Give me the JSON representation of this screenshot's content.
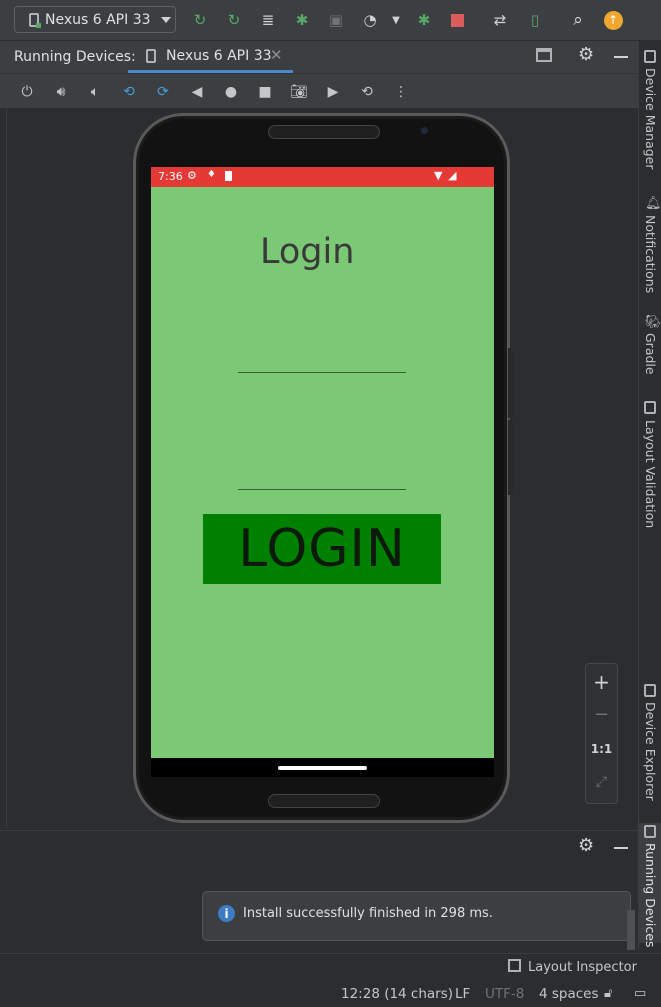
{
  "toolbar": {
    "device_selector": "Nexus 6 API 33",
    "icons": [
      "apply-changes-icon",
      "apply-code-changes-icon",
      "logcat-icon",
      "debug-icon",
      "attach-debugger-icon",
      "profiler-icon",
      "dropdown-icon",
      "debug-app-icon",
      "stop-icon",
      "device-manager-icon",
      "sync-icon",
      "search-icon",
      "update-icon"
    ]
  },
  "running_devices": {
    "label": "Running Devices:",
    "tab": "Nexus 6 API 33"
  },
  "phone": {
    "status_time": "7:36",
    "title": "Login",
    "button": "LOGIN"
  },
  "zoom": {
    "plus": "+",
    "minus": "−",
    "one_to_one": "1:1"
  },
  "right_panel": {
    "device_manager": "Device Manager",
    "notifications": "Notifications",
    "gradle": "Gradle",
    "layout_validation": "Layout Validation",
    "device_explorer": "Device Explorer",
    "running_devices": "Running Devices"
  },
  "notification": {
    "message": "Install successfully finished in 298 ms."
  },
  "layout_inspector": "Layout Inspector",
  "statusbar": {
    "position": "12:28 (14 chars)",
    "line_sep": "LF",
    "encoding": "UTF-8",
    "indent": "4 spaces"
  },
  "colors": {
    "status_bar": "#e53935",
    "app_background": "#7bc875",
    "login_button": "#008000"
  }
}
